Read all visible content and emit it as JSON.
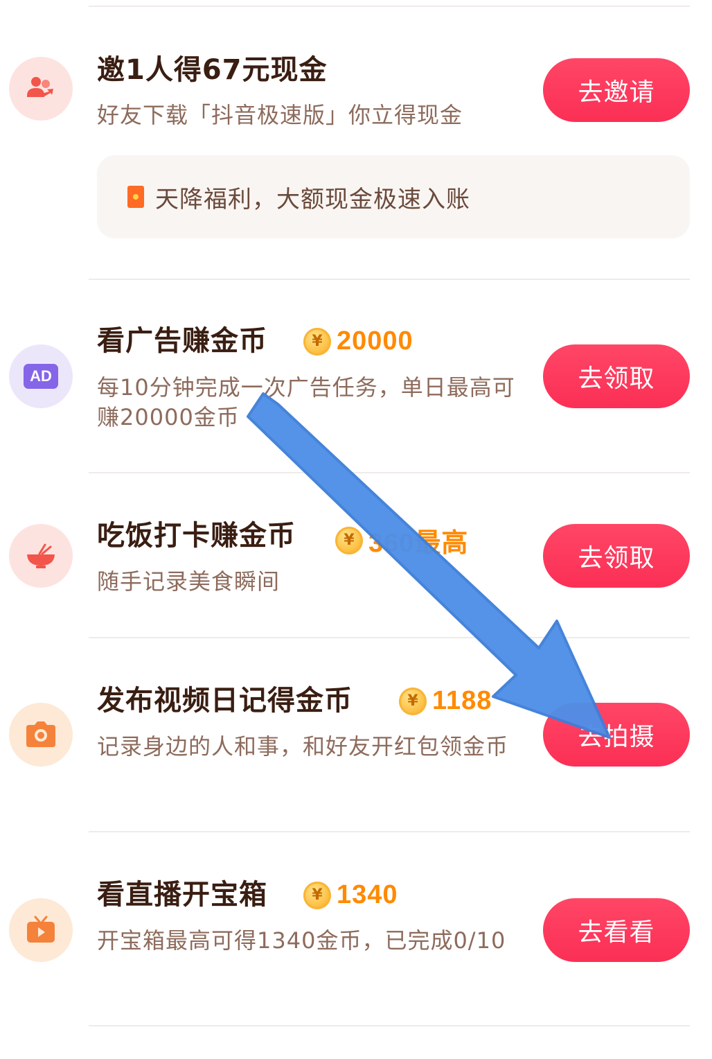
{
  "tasks": [
    {
      "title": "邀1人得67元现金",
      "description": "好友下载「抖音极速版」你立得现金",
      "button": "去邀请",
      "icon": "invite-users-icon",
      "banner": "天降福利，大额现金极速入账"
    },
    {
      "title": "看广告赚金币",
      "coin": "20000",
      "description": "每10分钟完成一次广告任务，单日最高可赚20000金币",
      "button": "去领取",
      "icon": "ad-icon",
      "icon_text": "AD"
    },
    {
      "title": "吃饭打卡赚金币",
      "coin": "360最高",
      "description": "随手记录美食瞬间",
      "button": "去领取",
      "icon": "food-bowl-icon"
    },
    {
      "title": "发布视频日记得金币",
      "coin": "1188",
      "description": "记录身边的人和事，和好友开红包领金币",
      "button": "去拍摄",
      "icon": "camera-icon"
    },
    {
      "title": "看直播开宝箱",
      "coin": "1340",
      "description": "开宝箱最高可得1340金币，已完成0/10",
      "button": "去看看",
      "icon": "tv-icon"
    }
  ],
  "coin_symbol": "¥",
  "colors": {
    "button": "#fb3458",
    "coin_text": "#ff8a00",
    "title": "#3a1e12",
    "desc": "#8d6b5c",
    "arrow": "#4f8fe8"
  },
  "overlay": {
    "arrow_icon": "blue-arrow-annotation"
  }
}
